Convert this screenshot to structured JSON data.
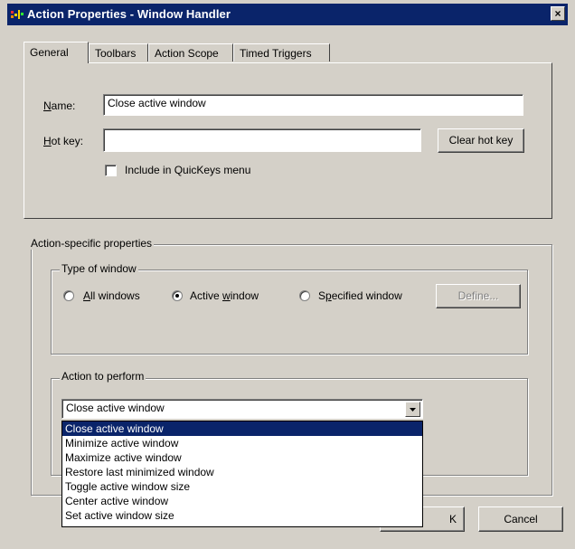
{
  "window": {
    "title": "Action Properties - Window Handler",
    "close_glyph": "×"
  },
  "tabs": [
    {
      "label": "General",
      "active": true
    },
    {
      "label": "Toolbars",
      "active": false
    },
    {
      "label": "Action Scope",
      "active": false
    },
    {
      "label": "Timed Triggers",
      "active": false
    }
  ],
  "general": {
    "name_label": "Name:",
    "name_value": "Close active window",
    "hotkey_label": "Hot key:",
    "hotkey_value": "",
    "clear_hotkey_label": "Clear hot key",
    "quickkeys_label": "Include in QuicKeys menu",
    "quickkeys_checked": false
  },
  "action_specific": {
    "group_label": "Action-specific properties",
    "type_group_label": "Type of window",
    "radio_all": "All windows",
    "radio_active": "Active window",
    "radio_specified": "Specified window",
    "selected_radio": "active",
    "define_label": "Define...",
    "perform_group_label": "Action to perform",
    "combo_value": "Close active window",
    "options": [
      "Close active window",
      "Minimize active window",
      "Maximize active window",
      "Restore last minimized window",
      "Toggle active window size",
      "Center active window",
      "Set active window size"
    ],
    "selected_option_index": 0
  },
  "footer": {
    "ok_label": "OK",
    "ok_visible": "K",
    "cancel_label": "Cancel"
  },
  "colors": {
    "titlebar": "#0a246a",
    "face": "#d4d0c8",
    "selection": "#0a246a"
  }
}
